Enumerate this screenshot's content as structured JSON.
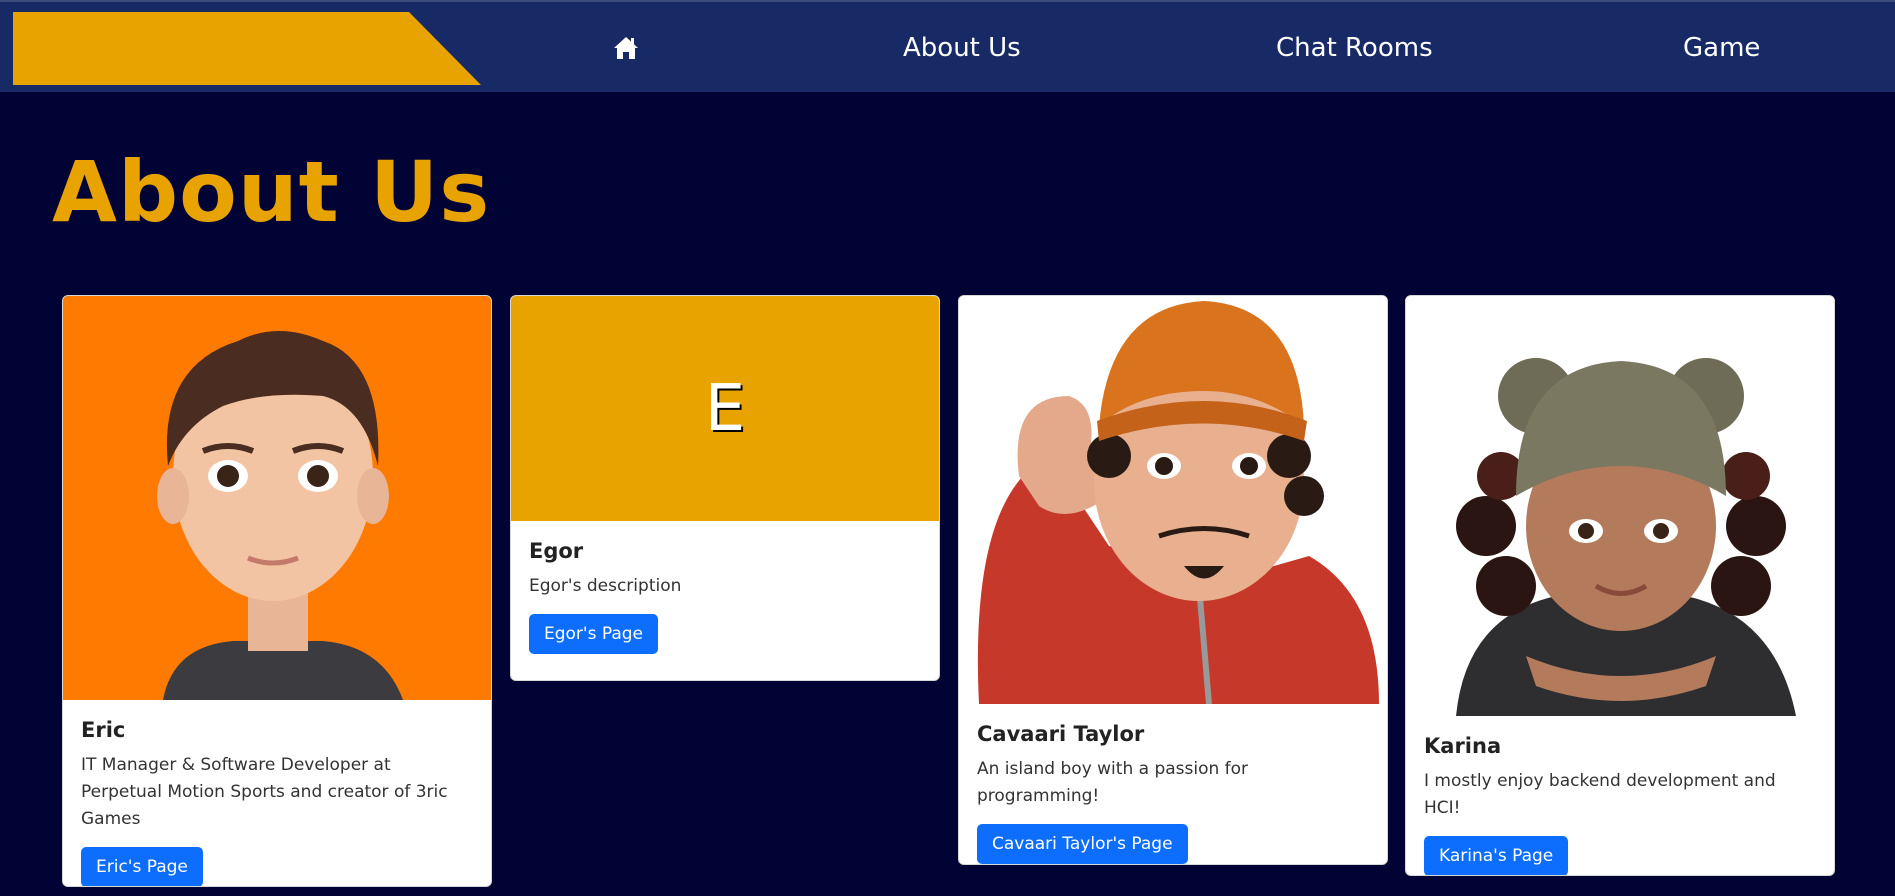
{
  "nav": {
    "home_icon": "home-icon",
    "about": "About Us",
    "chat": "Chat Rooms",
    "game": "Game"
  },
  "page": {
    "title": "About Us"
  },
  "colors": {
    "background": "#000333",
    "navbar": "#172a66",
    "accent": "#e8a300",
    "button": "#0d6efd"
  },
  "members": [
    {
      "name": "Eric",
      "description": "IT Manager & Software Developer at Perpetual Motion Sports and creator of 3ric Games",
      "button": "Eric's Page"
    },
    {
      "name": "Egor",
      "initial": "E",
      "description": "Egor's description",
      "button": "Egor's Page"
    },
    {
      "name": "Cavaari Taylor",
      "description": "An island boy with a passion for programming!",
      "button": "Cavaari Taylor's Page"
    },
    {
      "name": "Karina",
      "description": "I mostly enjoy backend development and HCI!",
      "button": "Karina's Page"
    }
  ]
}
